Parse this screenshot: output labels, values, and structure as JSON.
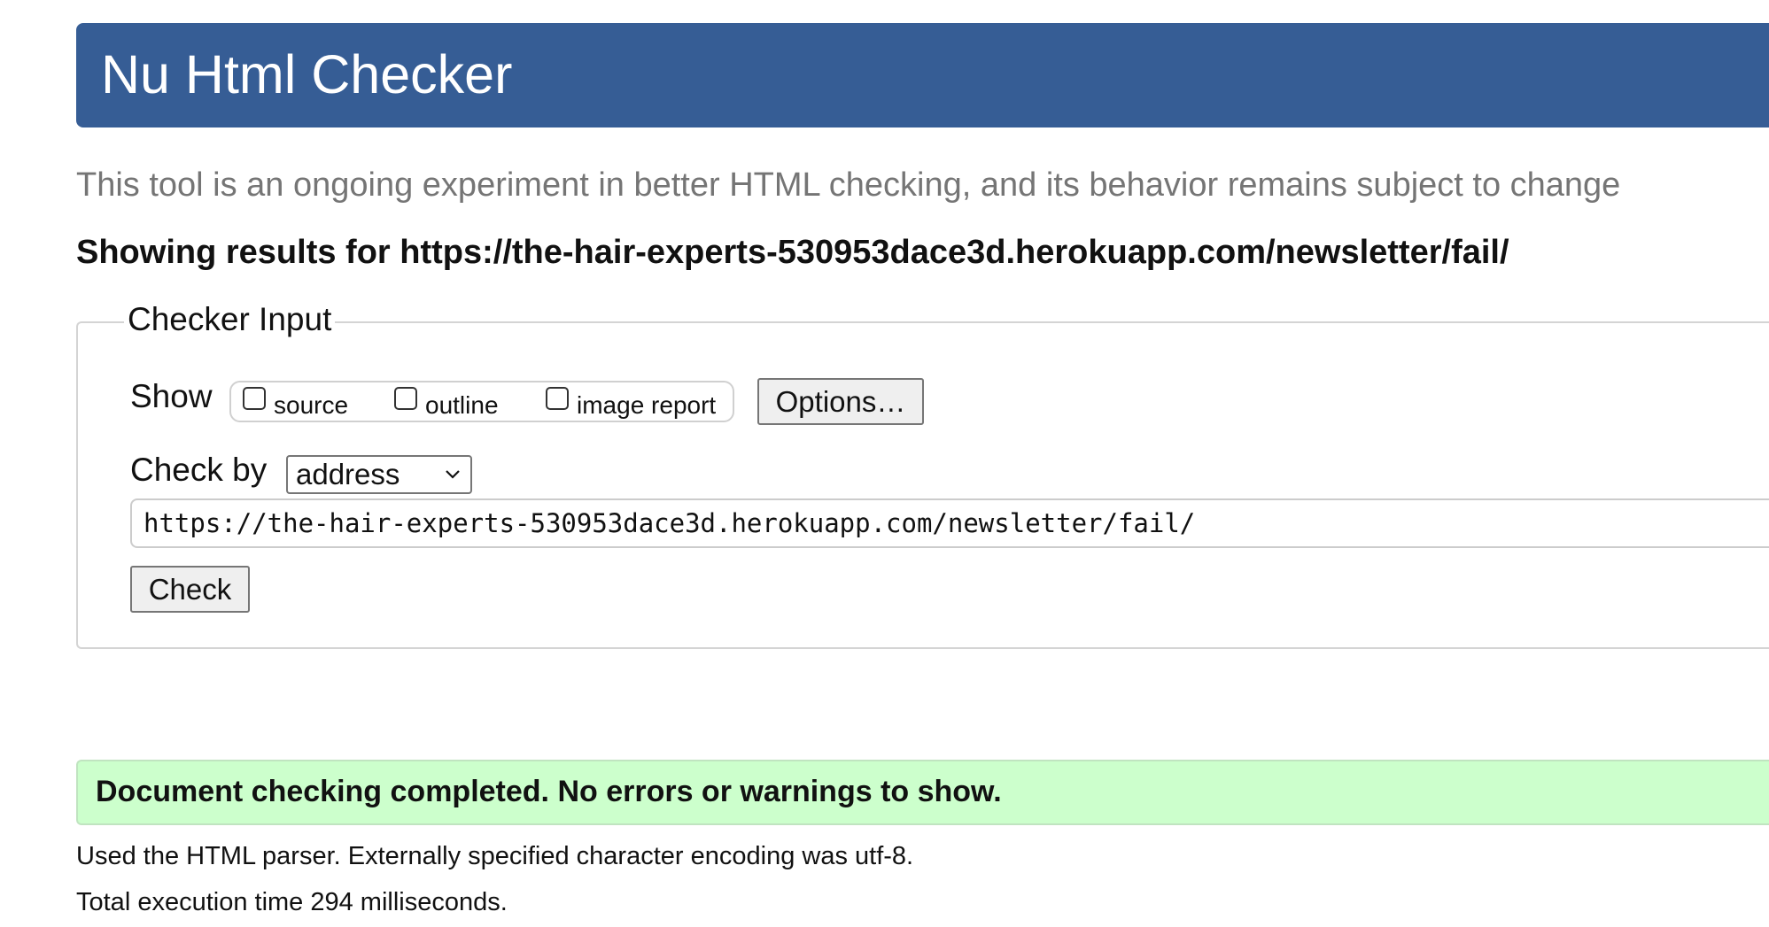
{
  "header": {
    "title": "Nu Html Checker"
  },
  "intro": {
    "subtitle": "This tool is an ongoing experiment in better HTML checking, and its behavior remains subject to change",
    "showing_results": "Showing results for https://the-hair-experts-530953dace3d.herokuapp.com/newsletter/fail/"
  },
  "checker_input": {
    "legend": "Checker Input",
    "show_label": "Show",
    "show_options": [
      {
        "label": "source",
        "checked": false
      },
      {
        "label": "outline",
        "checked": false
      },
      {
        "label": "image report",
        "checked": false
      }
    ],
    "options_button": "Options…",
    "check_by_label": "Check by",
    "check_by_value": "address",
    "url_value": "https://the-hair-experts-530953dace3d.herokuapp.com/newsletter/fail/",
    "check_button": "Check"
  },
  "results": {
    "success_message": "Document checking completed. No errors or warnings to show.",
    "parser_info": "Used the HTML parser. Externally specified character encoding was utf-8.",
    "execution_time": "Total execution time 294 milliseconds."
  },
  "colors": {
    "header_bg": "#365d95",
    "success_bg": "#ccffcc",
    "subtitle_text": "#757575"
  }
}
